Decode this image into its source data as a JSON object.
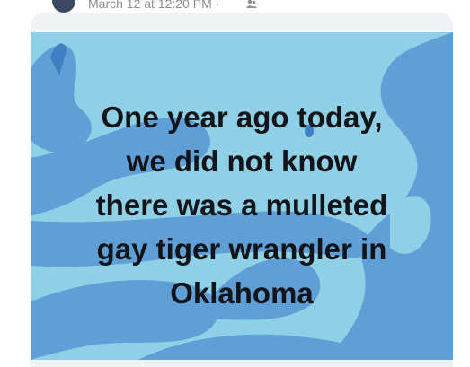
{
  "post": {
    "timestamp": "March 12 at 12:20 PM",
    "separator": "·",
    "audience_icon": "friends-icon"
  },
  "image": {
    "caption_lines": [
      "One year ago today,",
      "we did not know",
      "there was a mulleted",
      "gay tiger wrangler in",
      "Oklahoma"
    ],
    "background_color": "#8fd0e6",
    "shape_color": "#5f9fd6",
    "text_color": "#111418"
  }
}
